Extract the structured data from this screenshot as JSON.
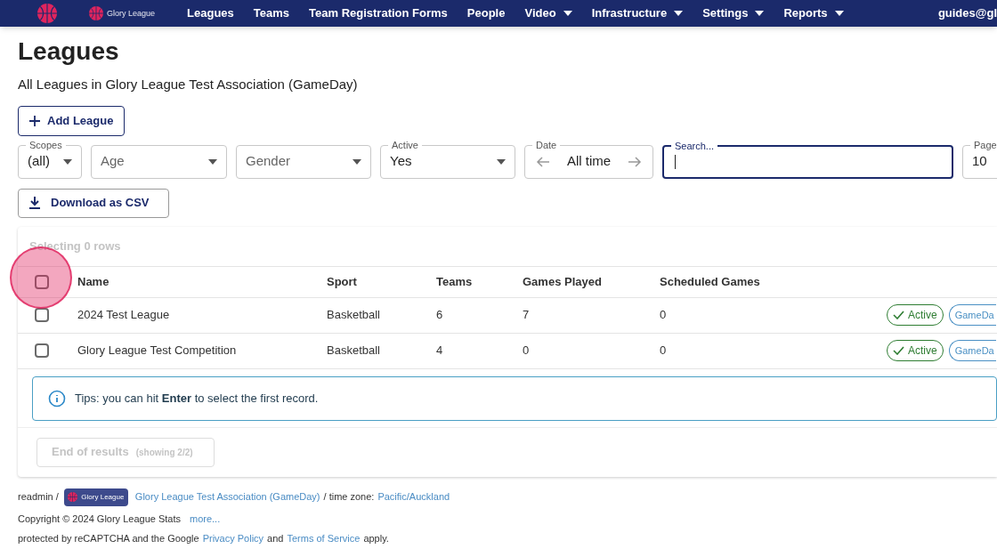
{
  "nav": {
    "logo_text": "Glory League",
    "items": [
      {
        "label": "Leagues",
        "dropdown": false
      },
      {
        "label": "Teams",
        "dropdown": false
      },
      {
        "label": "Team Registration Forms",
        "dropdown": false
      },
      {
        "label": "People",
        "dropdown": false
      },
      {
        "label": "Video",
        "dropdown": true
      },
      {
        "label": "Infrastructure",
        "dropdown": true
      },
      {
        "label": "Settings",
        "dropdown": true
      },
      {
        "label": "Reports",
        "dropdown": true
      }
    ],
    "user": "guides@gl"
  },
  "title": "Leagues",
  "subtitle": "All Leagues in Glory League Test Association (GameDay)",
  "add_button": "Add League",
  "filters": [
    {
      "kind": "select",
      "label": "Scopes",
      "value": "(all)"
    },
    {
      "kind": "select",
      "placeholder": "Age"
    },
    {
      "kind": "select",
      "placeholder": "Gender"
    },
    {
      "kind": "select",
      "label": "Active",
      "value": "Yes"
    },
    {
      "kind": "date",
      "label": "Date",
      "value": "All time"
    },
    {
      "kind": "search",
      "label": "Search...",
      "focused": true
    },
    {
      "kind": "select",
      "label": "Page",
      "value": "10"
    }
  ],
  "download_button": "Download as CSV",
  "table": {
    "selection_text": "Selecting 0 rows",
    "columns": [
      "Name",
      "Sport",
      "Teams",
      "Games Played",
      "Scheduled Games"
    ],
    "header_checked": false,
    "rows": [
      {
        "checked": false,
        "cells": [
          "2024 Test League",
          "Basketball",
          "6",
          "7",
          "0"
        ],
        "badges": [
          "Active",
          "GameDa"
        ]
      },
      {
        "checked": false,
        "cells": [
          "Glory League Test Competition",
          "Basketball",
          "4",
          "0",
          "0"
        ],
        "badges": [
          "Active",
          "GameDa"
        ]
      }
    ],
    "tip": "Tips: you can hit **Enter** to select the first record.",
    "end_button": "End of results",
    "end_note": "(showing 2/2)"
  },
  "footer": {
    "user": "readmin /",
    "logo_text": "Glory League",
    "association": "Glory League Test Association (GameDay)",
    "tz_label": "/ time zone:",
    "tz": "Pacific/Auckland",
    "copyright": "Copyright © 2024 Glory League Stats",
    "more": "more...",
    "recaptcha_pre": "protected by reCAPTCHA and the Google",
    "privacy": "Privacy Policy",
    "and": "and",
    "terms": "Terms of Service",
    "apply": "apply."
  }
}
